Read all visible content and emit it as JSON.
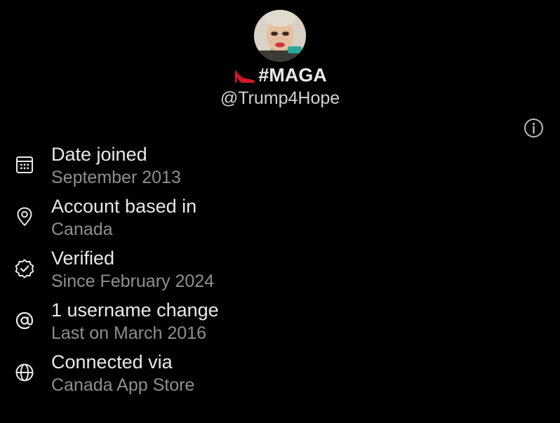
{
  "profile": {
    "display_name": "#MAGA",
    "name_emoji_icon": "high-heel-shoe-icon",
    "handle": "@Trump4Hope",
    "avatar_icon": "profile-photo"
  },
  "about": {
    "items": [
      {
        "icon": "calendar-icon",
        "title": "Date joined",
        "detail": "September 2013"
      },
      {
        "icon": "location-pin-icon",
        "title": "Account based in",
        "detail": "Canada"
      },
      {
        "icon": "verified-badge-icon",
        "title": "Verified",
        "detail": "Since February 2024",
        "action_icon": "info-circle-icon"
      },
      {
        "icon": "at-sign-icon",
        "title": "1 username change",
        "detail": "Last on March 2016"
      },
      {
        "icon": "globe-icon",
        "title": "Connected via",
        "detail": "Canada App Store"
      }
    ]
  },
  "colors": {
    "background": "#000000",
    "primary_text": "#e7e9ea",
    "secondary_text": "#8b9095",
    "icon_color": "#e7e9ea"
  }
}
